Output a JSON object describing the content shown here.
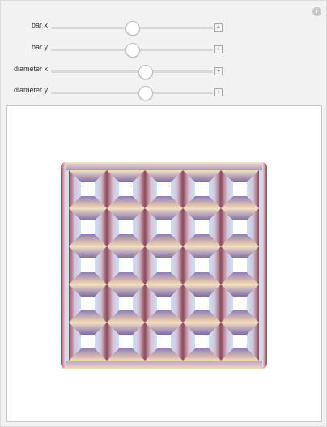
{
  "controls": [
    {
      "label": "bar x",
      "value": 0.5
    },
    {
      "label": "bar y",
      "value": 0.5
    },
    {
      "label": "diameter x",
      "value": 0.58
    },
    {
      "label": "diameter y",
      "value": 0.58
    }
  ],
  "icons": {
    "corner": "plus-circle-icon",
    "stepper": "plus-square-icon"
  },
  "plot": {
    "grid_cols": 5,
    "grid_rows": 5,
    "colors": {
      "light_blue": "#c9e2f7",
      "peach": "#f7d9b0",
      "lavender": "#8f7eb5",
      "maroon": "#8f4a58",
      "plot_border": "#c9c9c9"
    }
  }
}
